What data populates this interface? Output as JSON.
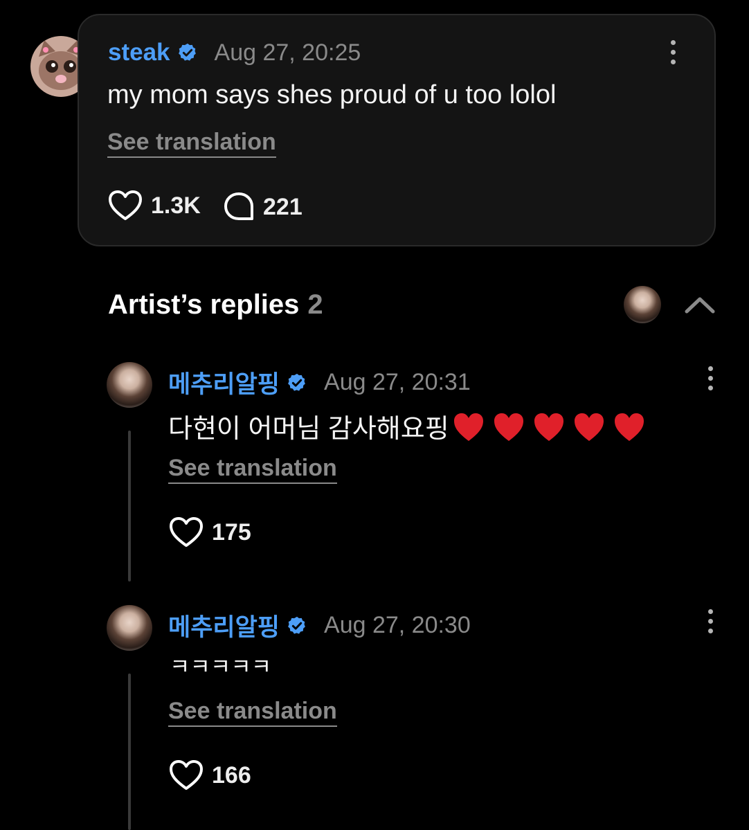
{
  "colors": {
    "background": "#000000",
    "card_background": "#141414",
    "username": "#4d9ef7",
    "muted": "#8a8a8a",
    "verified_badge": "#4d9ef7",
    "heart_emoji": "#e0202a"
  },
  "comment": {
    "username": "steak",
    "timestamp": "Aug 27, 20:25",
    "text": "my mom says shes proud of u too lolol",
    "see_translation": "See translation",
    "likes": "1.3K",
    "replies": "221",
    "icons": [
      "verified-badge-icon",
      "more-icon",
      "heart-icon",
      "comment-icon"
    ]
  },
  "artist_replies": {
    "title": "Artist’s replies",
    "count": "2",
    "icons": [
      "avatar",
      "chevron-up-icon"
    ]
  },
  "replies": [
    {
      "username": "메추리알핑",
      "timestamp": "Aug 27, 20:31",
      "text": "다현이 어머님 감사해요핑",
      "emoji": "❤️❤️❤️❤️❤️",
      "see_translation": "See translation",
      "likes": "175"
    },
    {
      "username": "메추리알핑",
      "timestamp": "Aug 27, 20:30",
      "text": "ㅋㅋㅋㅋㅋ",
      "see_translation": "See translation",
      "likes": "166"
    }
  ]
}
